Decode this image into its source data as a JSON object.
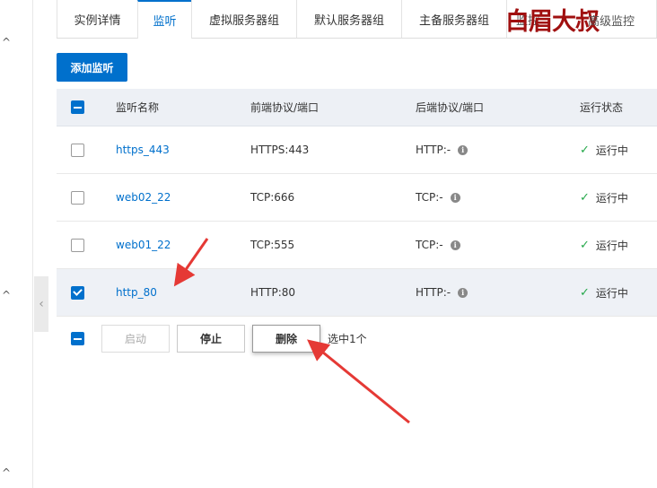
{
  "tabs": [
    {
      "label": "实例详情"
    },
    {
      "label": "监听"
    },
    {
      "label": "虚拟服务器组"
    },
    {
      "label": "默认服务器组"
    },
    {
      "label": "主备服务器组"
    },
    {
      "label": "监控"
    }
  ],
  "watermark": {
    "text": "白眉大叔",
    "tail": "高级监控"
  },
  "add_button": "添加监听",
  "table": {
    "headers": {
      "name": "监听名称",
      "front": "前端协议/端口",
      "back": "后端协议/端口",
      "status": "运行状态"
    },
    "rows": [
      {
        "name": "https_443",
        "front": "HTTPS:443",
        "back": "HTTP:-",
        "status": "运行中",
        "checked": false
      },
      {
        "name": "web02_22",
        "front": "TCP:666",
        "back": "TCP:-",
        "status": "运行中",
        "checked": false
      },
      {
        "name": "web01_22",
        "front": "TCP:555",
        "back": "TCP:-",
        "status": "运行中",
        "checked": false
      },
      {
        "name": "http_80",
        "front": "HTTP:80",
        "back": "HTTP:-",
        "status": "运行中",
        "checked": true
      }
    ]
  },
  "footer": {
    "start": "启动",
    "stop": "停止",
    "delete": "删除",
    "selected_text": "选中1个"
  },
  "icons": {
    "info": "i",
    "ok": "✓",
    "collapse": "‹",
    "chevron_up": "^"
  },
  "colors": {
    "primary": "#0070cc",
    "success": "#25a84a",
    "annotation": "#e53935"
  }
}
